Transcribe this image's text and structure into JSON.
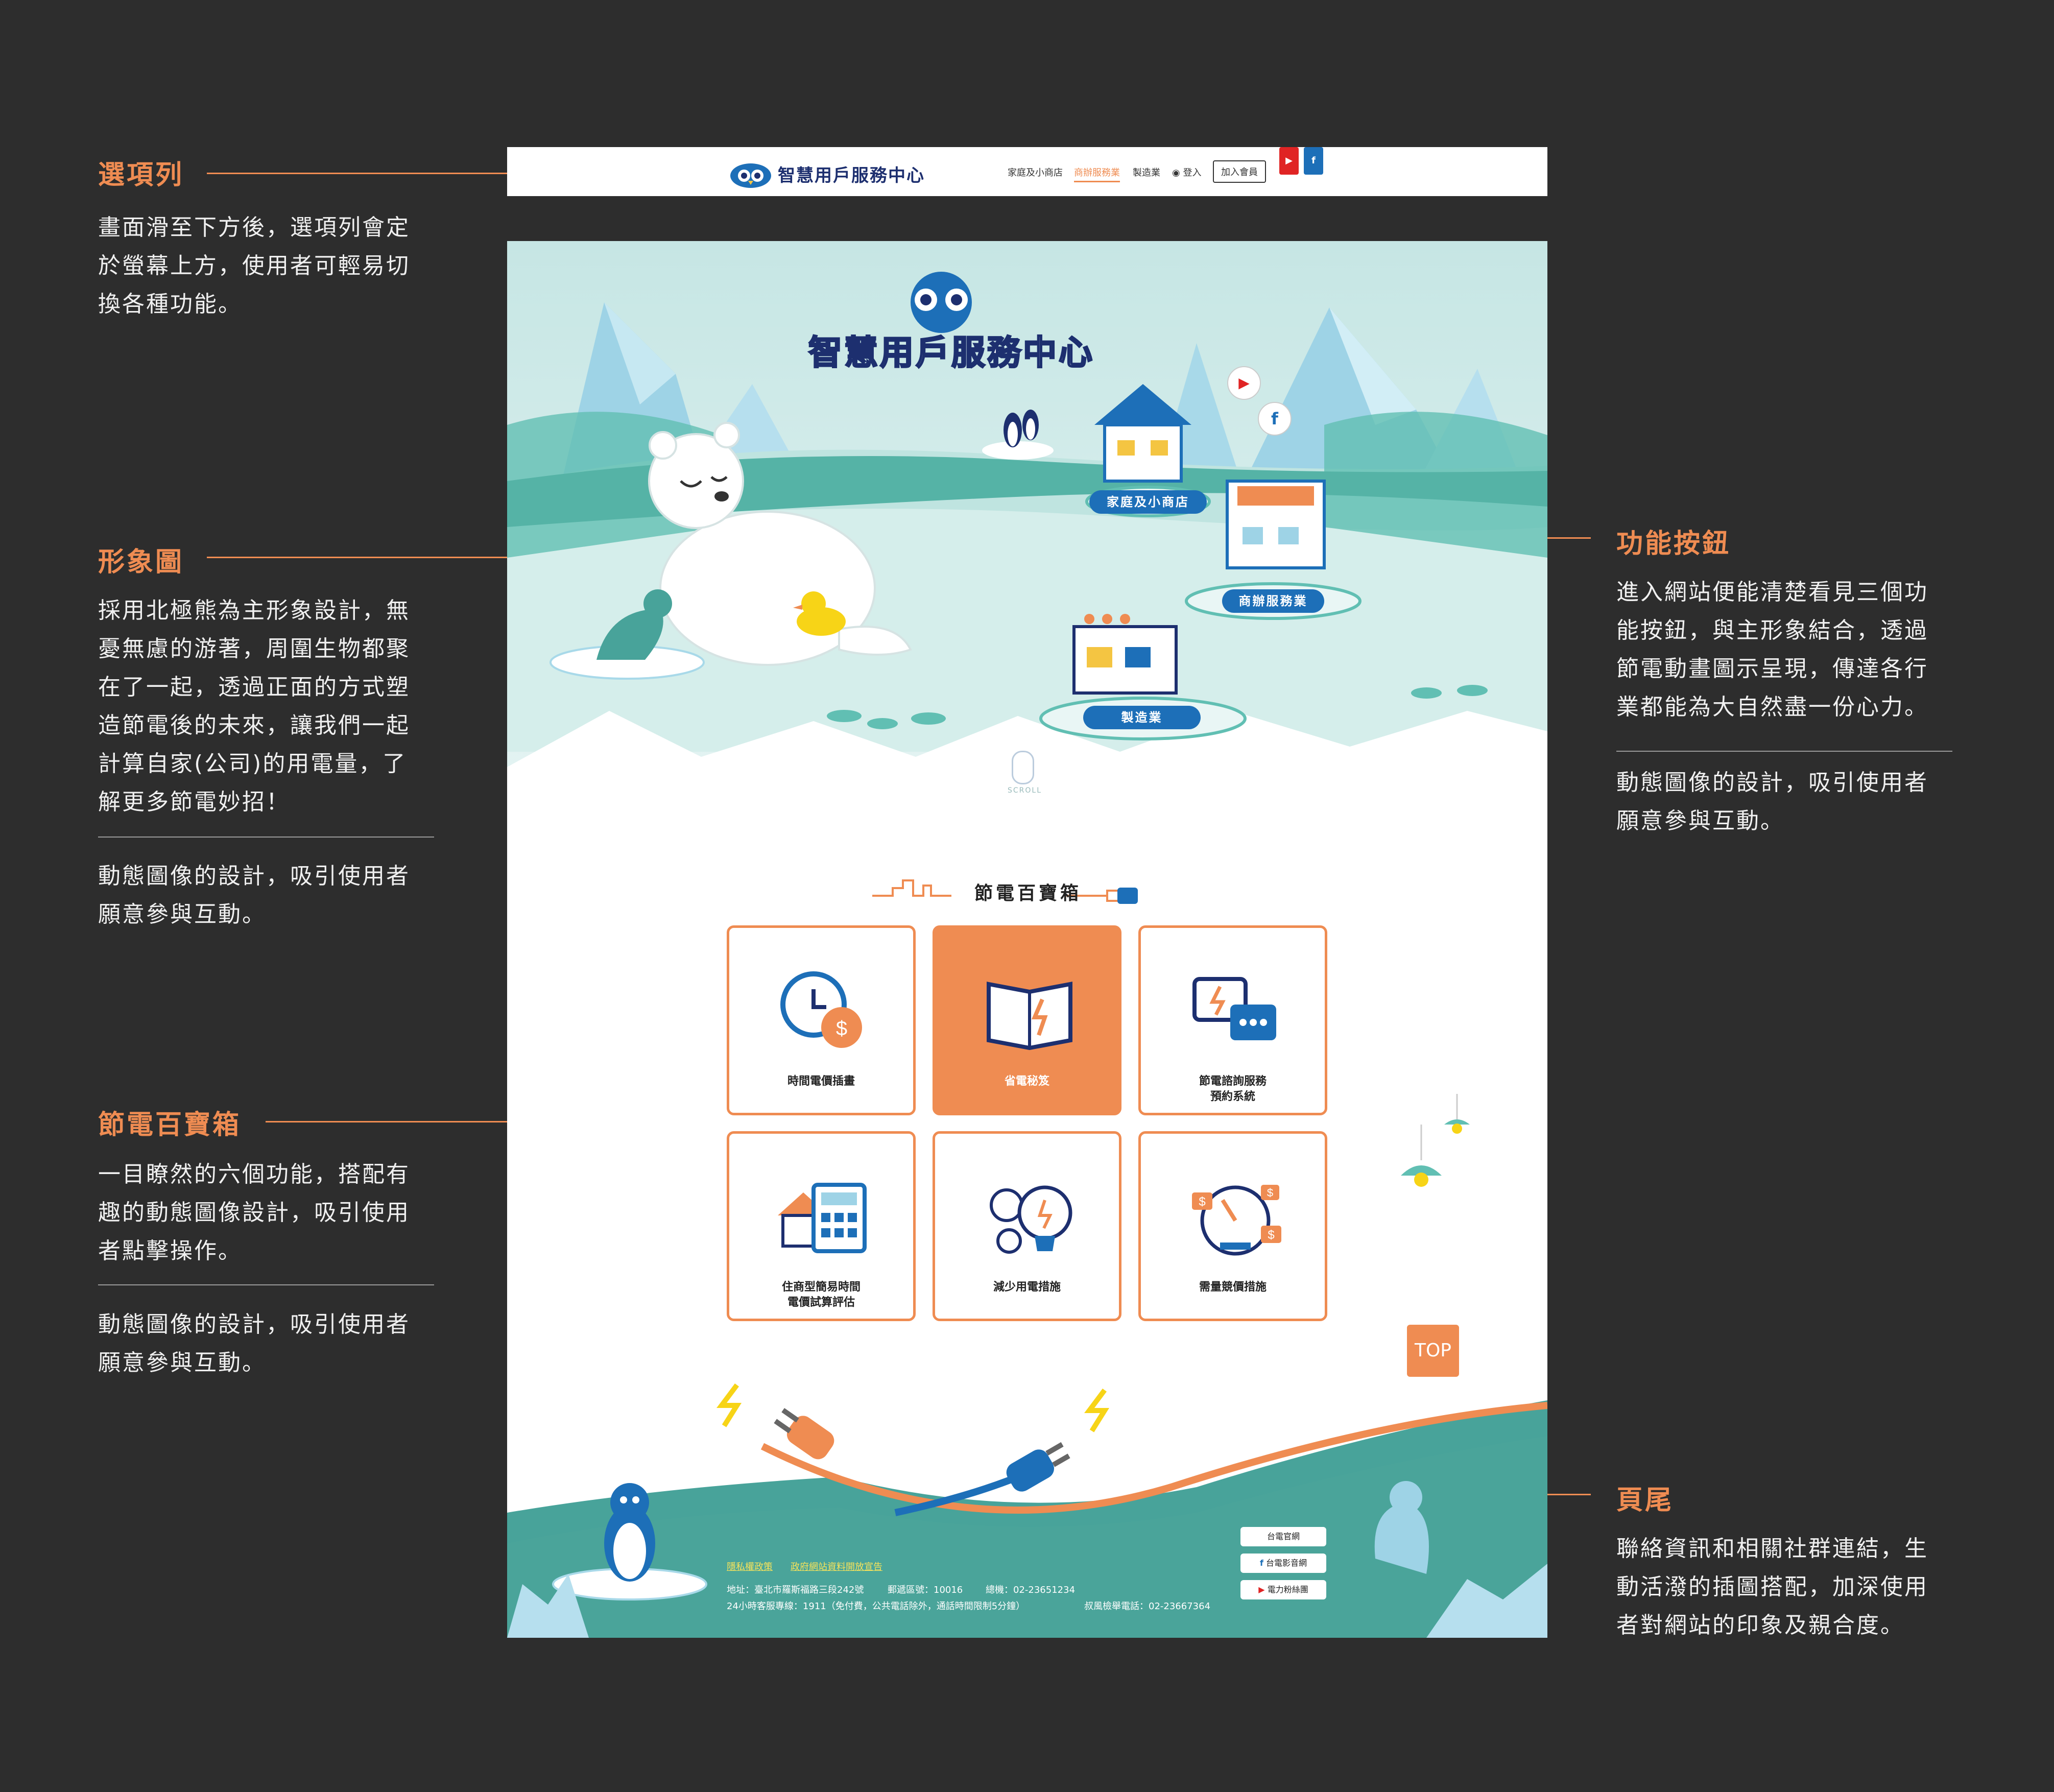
{
  "annotations": {
    "nav": {
      "title": "選項列",
      "text": [
        "畫面滑至下方後，選項列會定",
        "於螢幕上方，使用者可輕易切",
        "換各種功能。"
      ]
    },
    "hero": {
      "title": "形象圖",
      "text": [
        "採用北極熊為主形象設計，無",
        "憂無慮的游著，周圍生物都聚",
        "在了一起，透過正面的方式塑",
        "造節電後的未來，讓我們一起",
        "計算自家(公司)的用電量，了",
        "解更多節電妙招！"
      ],
      "note": [
        "動態圖像的設計，吸引使用者",
        "願意參與互動。"
      ]
    },
    "toolbox": {
      "title": "節電百寶箱",
      "text": [
        "一目瞭然的六個功能，搭配有",
        "趣的動態圖像設計，吸引使用",
        "者點擊操作。"
      ],
      "note": [
        "動態圖像的設計，吸引使用者",
        "願意參與互動。"
      ]
    },
    "features": {
      "title": "功能按鈕",
      "text": [
        "進入網站便能清楚看見三個功",
        "能按鈕，與主形象結合，透過",
        "節電動畫圖示呈現，傳達各行",
        "業都能為大自然盡一份心力。"
      ],
      "note": [
        "動態圖像的設計，吸引使用者",
        "願意參與互動。"
      ]
    },
    "footer": {
      "title": "頁尾",
      "text": [
        "聯絡資訊和相關社群連結，生",
        "動活潑的插圖搭配，加深使用",
        "者對網站的印象及親合度。"
      ]
    }
  },
  "nav": {
    "brand": "智慧用戶服務中心",
    "items": [
      "家庭及小商店",
      "商辦服務業",
      "製造業"
    ],
    "active_index": 1,
    "login": "登入",
    "join": "加入會員",
    "youtube_icon": "youtube-icon",
    "facebook_icon": "facebook-icon"
  },
  "hero": {
    "logo_text": "智慧用戶服務中心",
    "buttons": [
      "家庭及小商店",
      "商辦服務業",
      "製造業"
    ],
    "scroll_hint": "SCROLL"
  },
  "toolbox": {
    "title": "節電百寶箱",
    "cards": [
      {
        "label": "時間電價插畫",
        "icon": "alarm-clock-money-icon"
      },
      {
        "label": "省電秘笈",
        "icon": "open-book-icon",
        "active": true
      },
      {
        "label": "節電諮詢服務\n預約系統",
        "icon": "chat-bubbles-icon"
      },
      {
        "label": "住商型簡易時間\n電價試算評估",
        "icon": "house-calculator-icon"
      },
      {
        "label": "減少用電措施",
        "icon": "light-bulbs-icon"
      },
      {
        "label": "需量競價措施",
        "icon": "gauge-dollar-icon"
      }
    ],
    "top_button": "TOP"
  },
  "footer": {
    "links": [
      "隱私權政策",
      "政府網站資料開放宣告"
    ],
    "address": "地址：臺北市羅斯福路三段242號",
    "postal": "郵遞區號：10016",
    "phone": "總機：02-23651234",
    "service": "24小時客服專線：1911（免付費，公共電話除外，通話時間限制5分鐘）",
    "fax": "叔風檢舉電話：02-23667364",
    "social": [
      "台電官網",
      "台電影音網",
      "電力粉絲團"
    ]
  },
  "colors": {
    "accent": "#ef8c52",
    "navy": "#1d2f6f",
    "blue": "#1d6fb8",
    "teal": "#48a39a",
    "ice": "#d8efee",
    "background": "#2d2d2d"
  }
}
